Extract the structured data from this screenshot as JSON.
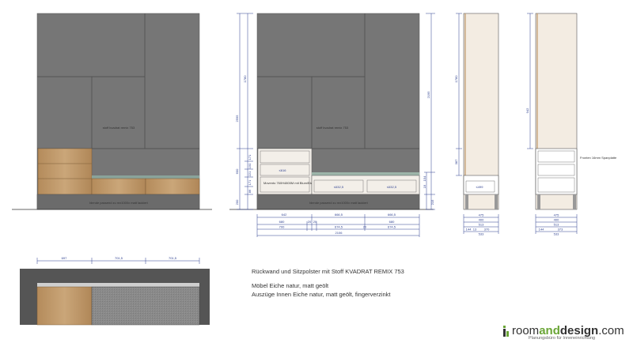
{
  "elevation_left": {
    "fabric_label": "stoff kvadrat remix 753",
    "base_label": "blende passend zu mx1000x matt lackiert"
  },
  "elevation_mid": {
    "fabric_label": "stoff kvadrat remix 753",
    "base_label": "blende passend zu mx1000x matt lackiert",
    "drawer_note": "Movento 760H4800M mit Blum/Blumotion",
    "inner_widths": [
      "≤616",
      "≤632,5",
      "≤632,5"
    ],
    "dim_total_height": "2595",
    "dim_upper": "1780",
    "dim_lower_stack": [
      "600",
      "171",
      "150",
      "221",
      "171",
      "86",
      "200"
    ],
    "dim_right_height": "2195",
    "dim_right_small": [
      "154",
      "19",
      "215"
    ],
    "dim_row1": [
      "642",
      "666,5",
      "666,5"
    ],
    "dim_row2": [
      "680",
      "20",
      "20",
      "680"
    ],
    "dim_row3": [
      "700",
      "674,5",
      "20",
      "674,5"
    ],
    "dim_total_width": "2106"
  },
  "section_one": {
    "dim_height": "1780",
    "dim_lower": "387",
    "inner_label": "≤499",
    "dims_bottom": [
      "475",
      "400",
      "513",
      "144",
      "13",
      "370",
      "533"
    ]
  },
  "section_two": {
    "dim_height": "942",
    "front_label": "Fronten 16mm Spanplatte",
    "dims_bottom": [
      "475",
      "400",
      "513",
      "144",
      "373",
      "533"
    ]
  },
  "plan_view": {
    "dims": [
      "697",
      "701,5",
      "701,5"
    ]
  },
  "notes": {
    "line1": "Rückwand und Sitzpolster mit Stoff KVADRAT REMIX 753",
    "line2": "Möbel Eiche natur, matt geölt",
    "line3": "Auszüge Innen Eiche natur, matt geölt, fingerverzinkt"
  },
  "logo": {
    "part1": "room",
    "part2": "and",
    "part3": "design",
    "part4": ".com",
    "tagline": "Planungsbüro für Inneneinrichtung"
  },
  "colors": {
    "fabric_gray": "#7d7d7d",
    "oak": "#c09a6b",
    "dimension_blue": "#2c3f8f",
    "brand_green": "#6aa536"
  }
}
